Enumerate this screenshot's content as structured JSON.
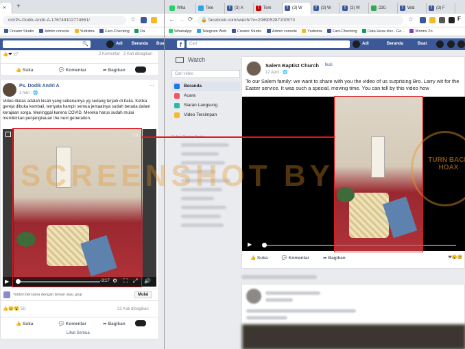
{
  "left_browser": {
    "new_tab_symbol": "+",
    "url": "cm/Ps-Dodik-Andri-A-176749102774651/",
    "bookmarks": [
      "Creator Studio",
      "Admin console",
      "Yudistira",
      "Fact-Checking",
      "Da"
    ],
    "post_top": {
      "reaction_count": "27",
      "comments": "2 Komentar",
      "shares": "3 Kali dibagikan",
      "like": "Suka",
      "comment": "Komentar",
      "share": "Bagikan"
    },
    "post": {
      "author": "Ps. Dodik Andri A",
      "time": "1 hari",
      "text": "Video diatas adalah kisah yang sebenarnya yg sedang terjadi di Italia. Ketika gereja dibuka kembali, ternyata hampir semua jemaatnya sudah berada dalam kerajaan sorga. Meninggal karena COVID. Mereka harus sudah mulai memikirkan penjangkauan the next generation.",
      "video_time": "-3:17",
      "watch_together": "Tonton bersama dengan teman atau grup",
      "start_button": "Mulai",
      "reaction_count": "50",
      "shares": "22 Kali dibagikan",
      "like": "Suka",
      "comment": "Komentar",
      "share": "Bagikan",
      "see_all": "Lihat Semua"
    }
  },
  "right_browser": {
    "tabs": [
      "Wha",
      "Tele",
      "(3) A",
      "Tem",
      "(3) W",
      "(3) W",
      "(3) W",
      "230.",
      "Wat",
      "(3) F"
    ],
    "url": "facebook.com/watch/?v=208905287200573",
    "bookmarks": [
      "WhatsApp",
      "Telegram Web",
      "Creator Studio",
      "Admin console",
      "Yudistira",
      "Fact-Checking",
      "Data Hoax.xlsx - Go...",
      "Worms Zo"
    ],
    "fb_search_placeholder": "Cari",
    "fb_user": "Adi",
    "fb_home": "Beranda",
    "fb_create": "Buat",
    "watch": {
      "title": "Watch",
      "search_placeholder": "Cari video",
      "nav": [
        "Beranda",
        "Acara",
        "Siaran Langsung",
        "Video Tersimpan"
      ],
      "list_title": "Daftar Tonton Anda"
    },
    "post": {
      "page_name": "Salem Baptist Church",
      "follow": "Ikuti",
      "date": "12 April",
      "text": "To our Salem family: we want to share with you the video of us surprising Bro. Larry wit for the Easter service. It was such a special, moving time. You can tell by this video how",
      "like": "Suka",
      "comment": "Komentar",
      "share": "Bagikan"
    },
    "side_logo_text": "TURN BACK HOAX"
  },
  "watermark": "SCREENSHOT BY",
  "colors": {
    "facebook_blue": "#3b5998",
    "highlight_red": "#e0171d"
  }
}
